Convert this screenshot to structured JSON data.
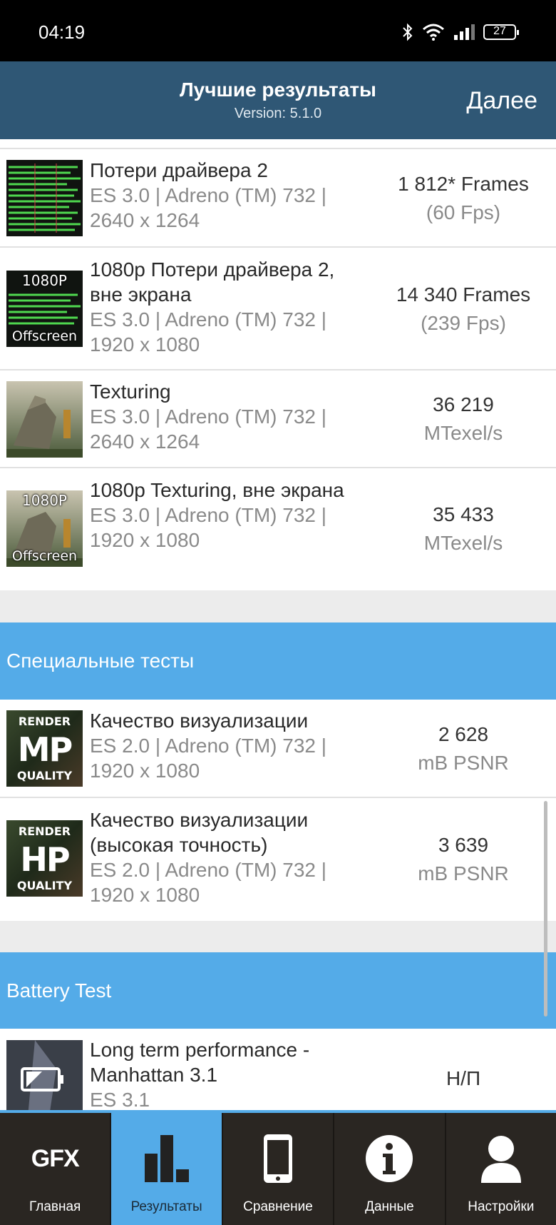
{
  "status_bar": {
    "time": "04:19",
    "battery": "27"
  },
  "header": {
    "title": "Лучшие результаты",
    "version": "Version: 5.1.0",
    "next_label": "Далее"
  },
  "thumb_labels": {
    "p1080": "1080P",
    "offscreen": "Offscreen",
    "render": "RENDER",
    "quality": "QUALITY",
    "mp": "MP",
    "hp": "HP"
  },
  "results": [
    {
      "title": "Потери драйвера 2",
      "sub": "ES 3.0 | Adreno (TM) 732 | 2640 x 1264",
      "score": "1 812* Frames",
      "unit": "(60 Fps)"
    },
    {
      "title": "1080p Потери драйвера 2, вне экрана",
      "sub": "ES 3.0 | Adreno (TM) 732 | 1920 x 1080",
      "score": "14 340 Frames",
      "unit": "(239 Fps)"
    },
    {
      "title": "Texturing",
      "sub": "ES 3.0 | Adreno (TM) 732 | 2640 x 1264",
      "score": "36 219",
      "unit": "MTexel/s"
    },
    {
      "title": "1080p Texturing, вне экрана",
      "sub": "ES 3.0 | Adreno (TM) 732 | 1920 x 1080",
      "score": "35 433",
      "unit": "MTexel/s"
    }
  ],
  "special_section": {
    "title": "Специальные тесты"
  },
  "special_results": [
    {
      "title": "Качество визуализации",
      "sub": "ES 2.0 | Adreno (TM) 732 | 1920 x 1080",
      "score": "2 628",
      "unit": "mB PSNR"
    },
    {
      "title": "Качество визуализации (высокая точность)",
      "sub": "ES 2.0 | Adreno (TM) 732 | 1920 x 1080",
      "score": "3 639",
      "unit": "mB PSNR"
    }
  ],
  "battery_section": {
    "title": "Battery Test"
  },
  "battery_results": [
    {
      "title": "Long term performance - Manhattan 3.1",
      "sub": "ES 3.1",
      "score": "Н/П"
    }
  ],
  "nav": {
    "gfx_logo": "GFX",
    "items": [
      {
        "label": "Главная",
        "icon": "gfx-logo-icon"
      },
      {
        "label": "Результаты",
        "icon": "bar-chart-icon"
      },
      {
        "label": "Сравнение",
        "icon": "phone-icon"
      },
      {
        "label": "Данные",
        "icon": "info-icon"
      },
      {
        "label": "Настройки",
        "icon": "user-icon"
      }
    ],
    "active_index": 1
  },
  "colors": {
    "header": "#2f5775",
    "section": "#54abe8",
    "nav_bg": "#2a2622"
  }
}
